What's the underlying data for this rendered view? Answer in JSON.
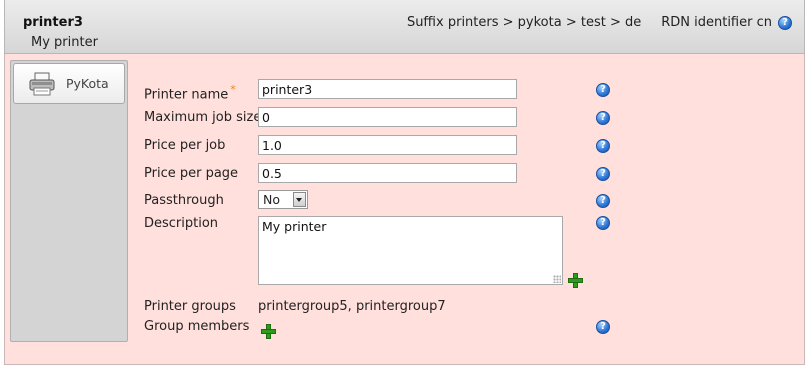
{
  "header": {
    "title": "printer3",
    "subtitle": "My printer",
    "suffix_label": "Suffix",
    "suffix_path": "printers > pykota > test > de",
    "rdn_label": "RDN identifier",
    "rdn_value": "cn"
  },
  "sidebar": {
    "tabs": [
      {
        "label": "PyKota",
        "icon": "printer-icon"
      }
    ]
  },
  "form": {
    "printer_name": {
      "label": "Printer name",
      "required_mark": "*",
      "value": "printer3"
    },
    "max_job_size": {
      "label": "Maximum job size",
      "value": "0"
    },
    "price_per_job": {
      "label": "Price per job",
      "value": "1.0"
    },
    "price_per_page": {
      "label": "Price per page",
      "value": "0.5"
    },
    "passthrough": {
      "label": "Passthrough",
      "value": "No"
    },
    "description": {
      "label": "Description",
      "value": "My printer"
    },
    "printer_groups": {
      "label": "Printer groups",
      "value": "printergroup5, printergroup7"
    },
    "group_members": {
      "label": "Group members"
    }
  },
  "icons": {
    "help": "help-icon",
    "add": "add-icon"
  },
  "colors": {
    "content_background": "#ffe0dc",
    "required_mark": "#e8861a",
    "add_icon": "#2e9a1e",
    "help_icon": "#2b76d6"
  }
}
